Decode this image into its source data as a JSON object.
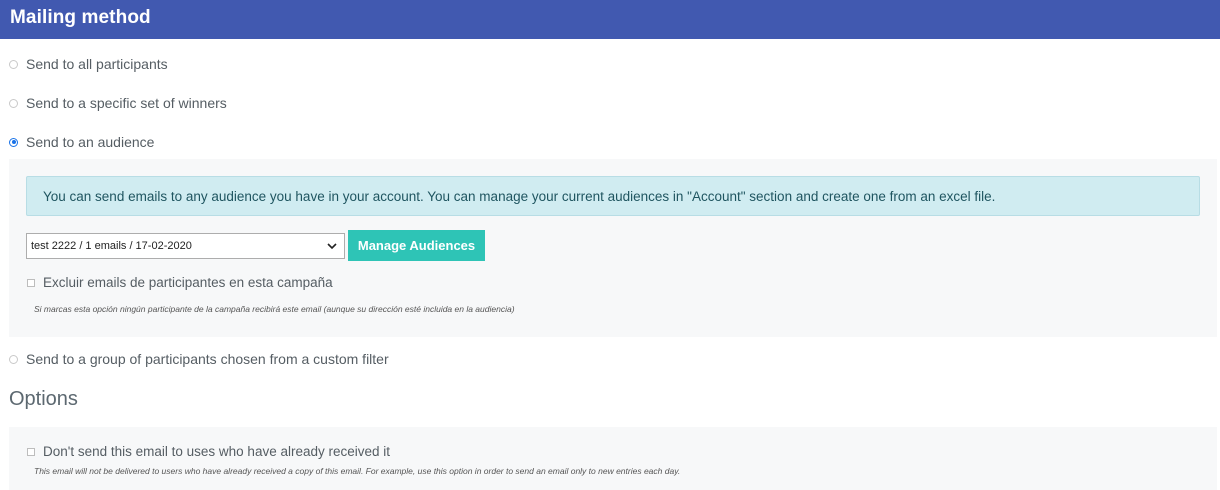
{
  "header": {
    "title": "Mailing method"
  },
  "mailing_options": [
    {
      "label": "Send to all participants",
      "checked": false
    },
    {
      "label": "Send to a specific set of winners",
      "checked": false
    },
    {
      "label": "Send to an audience",
      "checked": true
    },
    {
      "label": "Send to a group of participants chosen from a custom filter",
      "checked": false
    }
  ],
  "audience_panel": {
    "info_text": "You can send emails to any audience you have in your account. You can manage your current audiences in \"Account\" section and create one from an excel file.",
    "select_value": "test 2222 / 1 emails / 17-02-2020",
    "manage_button_label": "Manage Audiences",
    "exclude_label": "Excluir emails de participantes en esta campaña",
    "exclude_note": "Si marcas esta opción ningún participante de la campaña recibirá este email (aunque su dirección esté incluida en la audiencia)"
  },
  "options": {
    "title": "Options",
    "dont_send_label": "Don't send this email to uses who have already received it",
    "dont_send_note": "This email will not be delivered to users who have already received a copy of this email. For example, use this option in order to send an email only to new entries each day."
  },
  "colors": {
    "header": "#4159b0",
    "button": "#2ec4b6",
    "info_bg": "#d0ecf1",
    "radio_checked": "#1a73e8"
  }
}
